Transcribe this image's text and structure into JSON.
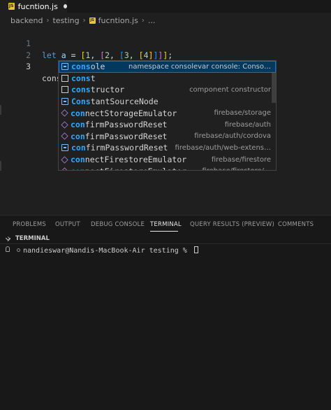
{
  "tab": {
    "icon_text": "JS",
    "label": "fucntion.js"
  },
  "breadcrumb": [
    "backend",
    "testing",
    "fucntion.js",
    "..."
  ],
  "editor": {
    "lines": [
      {
        "number": "1"
      },
      {
        "number": "2"
      },
      {
        "number": "3",
        "text": "cons"
      }
    ],
    "line1": {
      "kw": "let",
      "var": "a",
      "op": " = ",
      "b1o": "[",
      "n1": "1",
      "c1": ", ",
      "b2o": "[",
      "n2": "2",
      "c2": ", ",
      "b3o": "[",
      "n3": "3",
      "c3": ", ",
      "b4o": "[",
      "n4": "4",
      "b4c": "]",
      "b3c": "]",
      "b2c": "]",
      "b1c": "]",
      "semi": ";"
    }
  },
  "suggestions": [
    {
      "pre": "",
      "hl": "cons",
      "post": "ole",
      "detail": "namespace consolevar console: Conso…",
      "icon": "variable-icon"
    },
    {
      "pre": "",
      "hl": "cons",
      "post": "t",
      "detail": "",
      "icon": "keyword-icon"
    },
    {
      "pre": "",
      "hl": "cons",
      "post": "tructor",
      "detail": "component constructor",
      "icon": "keyword-icon"
    },
    {
      "pre": "",
      "hl": "Cons",
      "post": "tantSourceNode",
      "detail": "",
      "icon": "variable-icon"
    },
    {
      "pre": "",
      "hl": "con",
      "post": "nectStorageEmulator",
      "detail": "firebase/storage",
      "icon": "class-icon"
    },
    {
      "pre": "",
      "hl": "con",
      "post": "firmPasswordReset",
      "detail": "firebase/auth",
      "icon": "class-icon"
    },
    {
      "pre": "",
      "hl": "con",
      "post": "firmPasswordReset",
      "detail": "firebase/auth/cordova",
      "icon": "class-icon"
    },
    {
      "pre": "",
      "hl": "con",
      "post": "firmPasswordReset",
      "detail": "firebase/auth/web-extens…",
      "icon": "variable-icon"
    },
    {
      "pre": "",
      "hl": "con",
      "post": "nectFirestoreEmulator",
      "detail": "firebase/firestore",
      "icon": "class-icon"
    },
    {
      "pre": "",
      "hl": "con",
      "post": "nectFirestoreEmulator",
      "detail": "firebase/firestore/…",
      "icon": "class-icon"
    }
  ],
  "panel": {
    "tabs": [
      "PROBLEMS",
      "OUTPUT",
      "DEBUG CONSOLE",
      "TERMINAL",
      "QUERY RESULTS (PREVIEW)",
      "COMMENTS"
    ],
    "active_tab": "TERMINAL",
    "terminal_title": "TERMINAL",
    "prompt": "nandieswar@Nandis-MacBook-Air testing % "
  },
  "colors": {
    "editor_bg": "#1f1f1f",
    "accent": "#0078d4",
    "match_highlight": "#2aaaff"
  }
}
